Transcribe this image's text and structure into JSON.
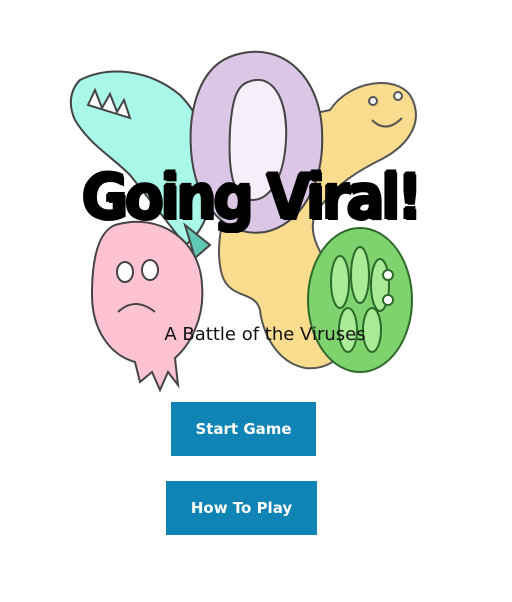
{
  "game": {
    "title": "Going Viral!",
    "subtitle": "A Battle of the Viruses"
  },
  "menu": {
    "start_label": "Start Game",
    "howto_label": "How To Play"
  },
  "colors": {
    "button_bg": "#0f84b5",
    "teal_virus": "#a8f7e8",
    "purple_virus": "#dcc6e6",
    "yellow_virus": "#f9dc8e",
    "pink_virus": "#fdc3d3",
    "green_virus": "#7fd36f"
  }
}
